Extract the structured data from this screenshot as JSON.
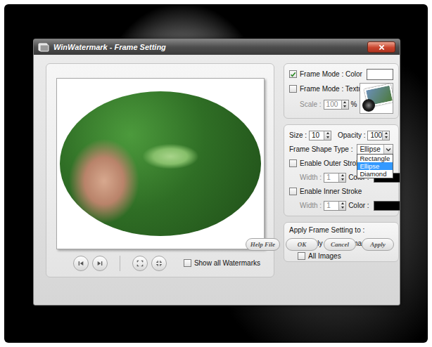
{
  "window": {
    "title": "WinWatermark - Frame Setting"
  },
  "preview": {
    "show_all_watermarks": {
      "label": "Show all Watermarks",
      "checked": false
    }
  },
  "frame_mode": {
    "color": {
      "label": "Frame Mode : Color",
      "checked": true,
      "color": "#ffffff"
    },
    "texture": {
      "label": "Frame Mode : Texture",
      "checked": false
    },
    "scale": {
      "label": "Scale :",
      "value": "100",
      "unit": "%",
      "disabled": true
    }
  },
  "shape": {
    "size": {
      "label": "Size :",
      "value": "10"
    },
    "opacity": {
      "label": "Opacity :",
      "value": "100"
    },
    "type": {
      "label": "Frame Shape Type :",
      "value": "Ellipse",
      "expanded": true,
      "options": [
        {
          "label": "Rectangle",
          "selected": false
        },
        {
          "label": "Ellipse",
          "selected": true
        },
        {
          "label": "Diamond",
          "selected": false
        }
      ]
    },
    "strokes": [
      {
        "label": "Enable Outer Stroke",
        "checked": false,
        "width_label": "Width :",
        "width": "1",
        "width_disabled": true,
        "color_label": "Color :",
        "color": "#000000"
      },
      {
        "label": "Enable Inner Stroke",
        "checked": false,
        "width_label": "Width :",
        "width": "1",
        "width_disabled": true,
        "color_label": "Color :",
        "color": "#000000"
      }
    ]
  },
  "apply": {
    "title": "Apply Frame Setting to :",
    "options": [
      {
        "label": "Only Current Image",
        "checked": true
      },
      {
        "label": "All Images",
        "checked": false
      }
    ]
  },
  "buttons": [
    {
      "label": "Help File"
    },
    {
      "label": "OK"
    },
    {
      "label": "Cancel"
    },
    {
      "label": "Apply"
    }
  ]
}
